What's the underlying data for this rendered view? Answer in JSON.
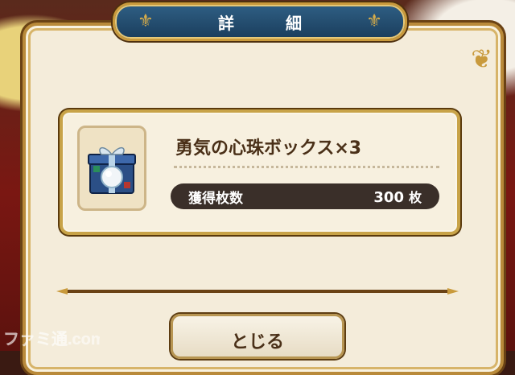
{
  "dialog": {
    "title": "詳　細",
    "close_label": "とじる"
  },
  "item": {
    "icon": "gift-box-icon",
    "name": "勇気の心珠ボックス×3",
    "count_label": "獲得枚数",
    "count_value": "300",
    "count_unit": "枚"
  },
  "watermark": {
    "text": "ファミ通.com"
  },
  "colors": {
    "banner_blue": "#1a3d5c",
    "gold_border": "#c8a348",
    "panel_cream": "#f4ecda",
    "count_bar": "#3a2f29"
  }
}
